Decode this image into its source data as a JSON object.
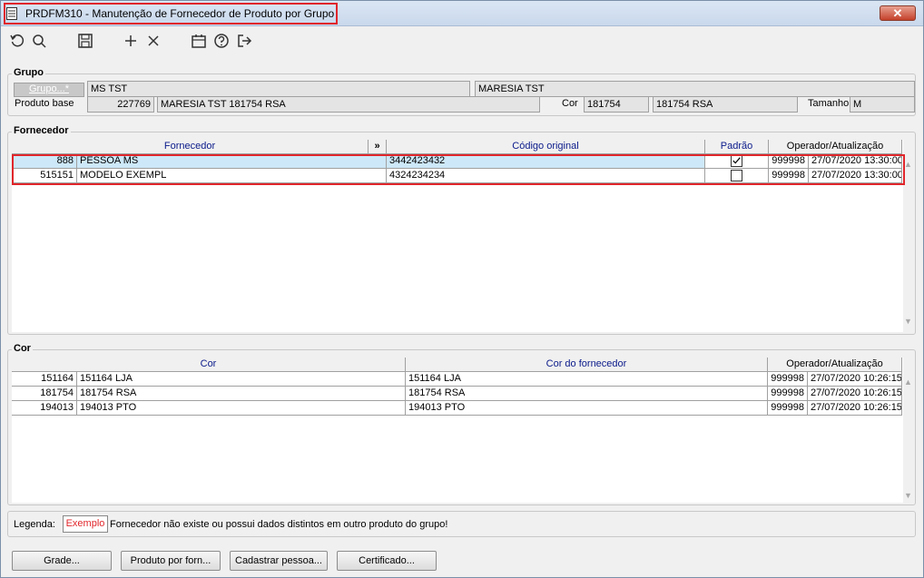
{
  "window": {
    "title": "PRDFM310 - Manutenção de Fornecedor de Produto por Grupo",
    "close": "✕"
  },
  "toolbar": {
    "icons": [
      "refresh-icon",
      "search-icon",
      "save-icon",
      "add-icon",
      "delete-icon",
      "calendar-icon",
      "help-icon",
      "exit-icon"
    ]
  },
  "grupo": {
    "legend": "Grupo",
    "grupo_button": "Grupo...*",
    "grupo_code": "MS TST",
    "grupo_desc": "MARESIA TST",
    "produto_base_label": "Produto base",
    "produto_base_code": "227769",
    "produto_base_desc": "MARESIA TST 181754 RSA",
    "cor_label": "Cor",
    "cor_code": "181754",
    "cor_desc": "181754 RSA",
    "tamanho_label": "Tamanho",
    "tamanho_value": "M"
  },
  "fornecedor": {
    "legend": "Fornecedor",
    "headers": {
      "fornecedor": "Fornecedor",
      "expand": "»",
      "codigo": "Código original",
      "padrao": "Padrão",
      "operador": "Operador/Atualização"
    },
    "rows": [
      {
        "code": "888",
        "name": "PESSOA MS",
        "codigo": "3442423432",
        "padrao": true,
        "operador": "999998",
        "data": "27/07/2020 13:30:00"
      },
      {
        "code": "515151",
        "name": "MODELO EXEMPL",
        "codigo": "4324234234",
        "padrao": false,
        "operador": "999998",
        "data": "27/07/2020 13:30:00"
      }
    ]
  },
  "cor": {
    "legend": "Cor",
    "headers": {
      "cor": "Cor",
      "cor_fornecedor": "Cor do fornecedor",
      "operador": "Operador/Atualização"
    },
    "rows": [
      {
        "code": "151164",
        "name": "151164 LJA",
        "cor_forn": "151164 LJA",
        "operador": "999998",
        "data": "27/07/2020 10:26:15"
      },
      {
        "code": "181754",
        "name": "181754 RSA",
        "cor_forn": "181754 RSA",
        "operador": "999998",
        "data": "27/07/2020 10:26:15"
      },
      {
        "code": "194013",
        "name": "194013 PTO",
        "cor_forn": "194013 PTO",
        "operador": "999998",
        "data": "27/07/2020 10:26:15"
      }
    ]
  },
  "legenda": {
    "label": "Legenda:",
    "exemplo": "Exemplo",
    "text": "Fornecedor não existe ou possui dados distintos em outro produto do grupo!"
  },
  "buttons": {
    "grade": "Grade...",
    "produto_forn": "Produto por forn...",
    "cadastrar": "Cadastrar pessoa...",
    "certificado": "Certificado..."
  },
  "colors": {
    "highlight": "#e0262b",
    "header_text": "#0a1a8a",
    "selected_row": "#cde8f8"
  }
}
